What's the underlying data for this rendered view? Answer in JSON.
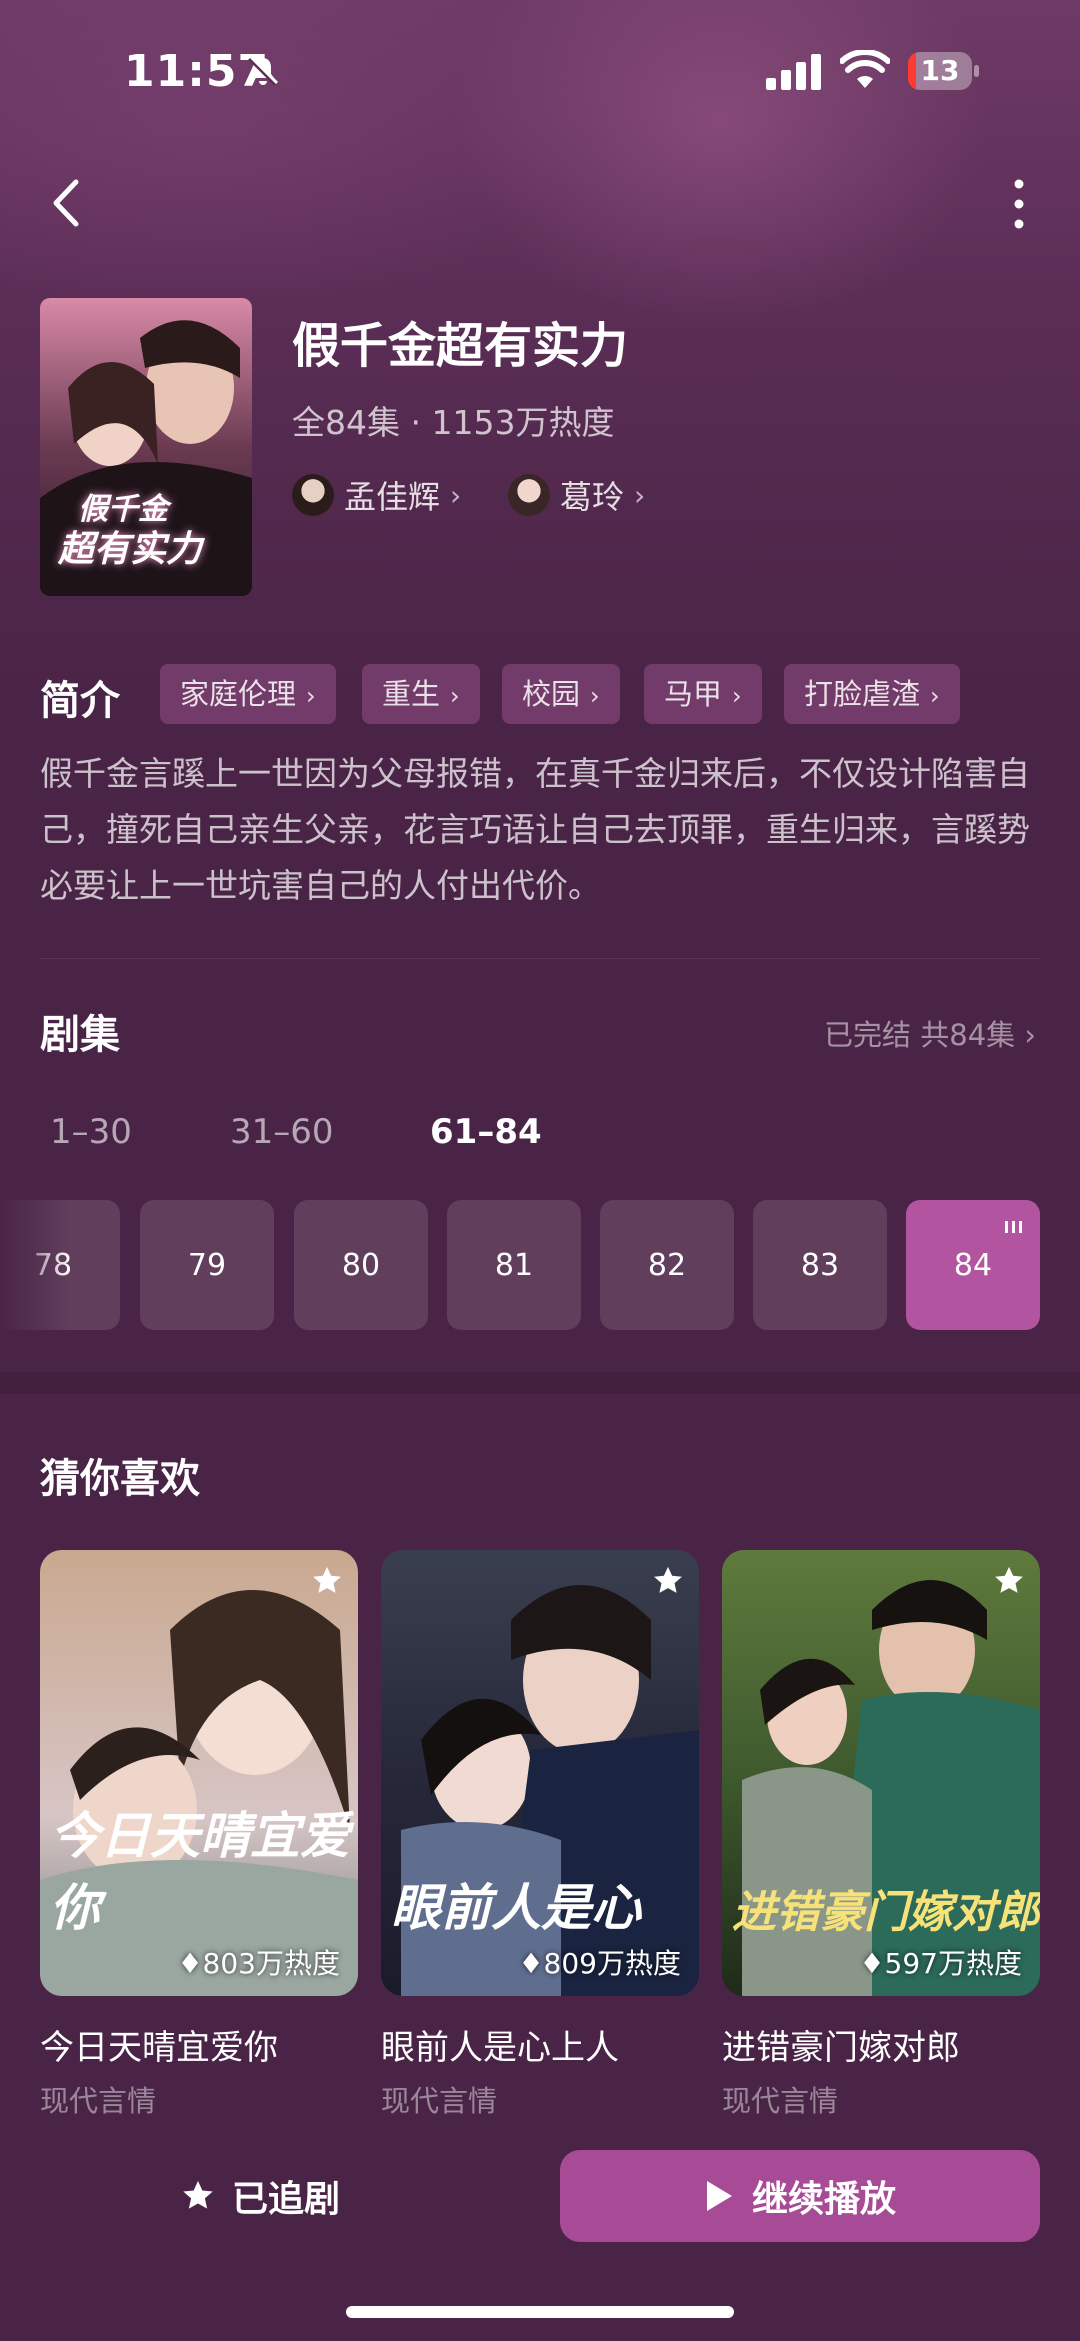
{
  "status_bar": {
    "time": "11:57",
    "battery": "13"
  },
  "drama": {
    "title": "假千金超有实力",
    "meta": "全84集 · 1153万热度",
    "cover_title_line1": "假千金",
    "cover_title_line2": "超有实力",
    "actors": [
      {
        "name": "孟佳辉"
      },
      {
        "name": "葛玲"
      }
    ]
  },
  "intro": {
    "heading": "简介",
    "tags": [
      "家庭伦理",
      "重生",
      "校园",
      "马甲",
      "打脸虐渣"
    ],
    "text": "假千金言蹊上一世因为父母报错，在真千金归来后，不仅设计陷害自己，撞死自己亲生父亲，花言巧语让自己去顶罪，重生归来，言蹊势必要让上一世坑害自己的人付出代价。"
  },
  "episodes": {
    "heading": "剧集",
    "status": "已完结 共84集",
    "ranges": [
      "1–30",
      "31–60",
      "61–84"
    ],
    "active_range": "61–84",
    "items": [
      "78",
      "79",
      "80",
      "81",
      "82",
      "83",
      "84"
    ],
    "current": "84"
  },
  "recommend": {
    "heading": "猜你喜欢",
    "items": [
      {
        "name": "今日天晴宜爱你",
        "genre": "现代言情",
        "heat": "803万热度",
        "poster_title": "今日天晴宜爱你"
      },
      {
        "name": "眼前人是心上人",
        "genre": "现代言情",
        "heat": "809万热度",
        "poster_title": "眼前人是心"
      },
      {
        "name": "进错豪门嫁对郎",
        "genre": "现代言情",
        "heat": "597万热度",
        "poster_title": "进错豪门嫁对郎"
      }
    ]
  },
  "actions": {
    "follow_label": "已追剧",
    "play_label": "继续播放"
  },
  "colors": {
    "accent": "#b2549f",
    "background": "#4a2446",
    "play_button": "#a84b97"
  },
  "icons": [
    "back-icon",
    "more-icon",
    "bell-slash-icon",
    "signal-icon",
    "wifi-icon",
    "star-icon",
    "play-icon",
    "flame-icon"
  ]
}
